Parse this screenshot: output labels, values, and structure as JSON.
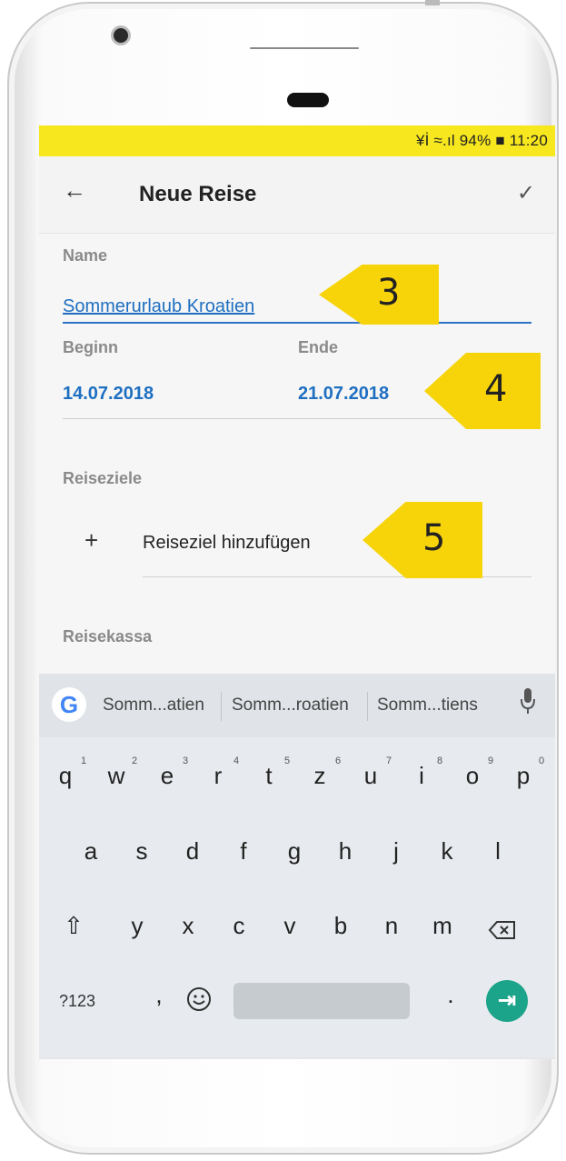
{
  "status_bar": {
    "text": "¥İ ≈.ıl 94% ■ 11:20"
  },
  "app_bar": {
    "back_icon": "arrow-left-icon",
    "title": "Neue Reise",
    "confirm_icon": "check-icon"
  },
  "form": {
    "name_label": "Name",
    "name_value": "Sommerurlaub Kroatien",
    "start_label": "Beginn",
    "start_value": "14.07.2018",
    "end_label": "Ende",
    "end_value": "21.07.2018",
    "destinations_label": "Reiseziele",
    "add_destination": "Reiseziel hinzufügen",
    "budget_label": "Reisekassa"
  },
  "callouts": [
    "3",
    "4",
    "5"
  ],
  "keyboard": {
    "suggestions": [
      "Somm...atien",
      "Somm...roatien",
      "Somm...tiens"
    ],
    "row1": [
      "q",
      "w",
      "e",
      "r",
      "t",
      "z",
      "u",
      "i",
      "o",
      "p"
    ],
    "row1_hints": [
      "1",
      "2",
      "3",
      "4",
      "5",
      "6",
      "7",
      "8",
      "9",
      "0"
    ],
    "row2": [
      "a",
      "s",
      "d",
      "f",
      "g",
      "h",
      "j",
      "k",
      "l"
    ],
    "row3": [
      "y",
      "x",
      "c",
      "v",
      "b",
      "n",
      "m"
    ],
    "symbols_key": "?123",
    "comma_key": ",",
    "period_key": ".",
    "shift_icon": "shift-icon",
    "backspace_icon": "backspace-icon",
    "emoji_icon": "emoji-icon",
    "enter_icon": "next-arrow-icon",
    "enter_color": "#1ba48a"
  },
  "colors": {
    "status_bar": "#f7e71e",
    "accent": "#1e6fc1",
    "callout": "#f7d40a"
  }
}
